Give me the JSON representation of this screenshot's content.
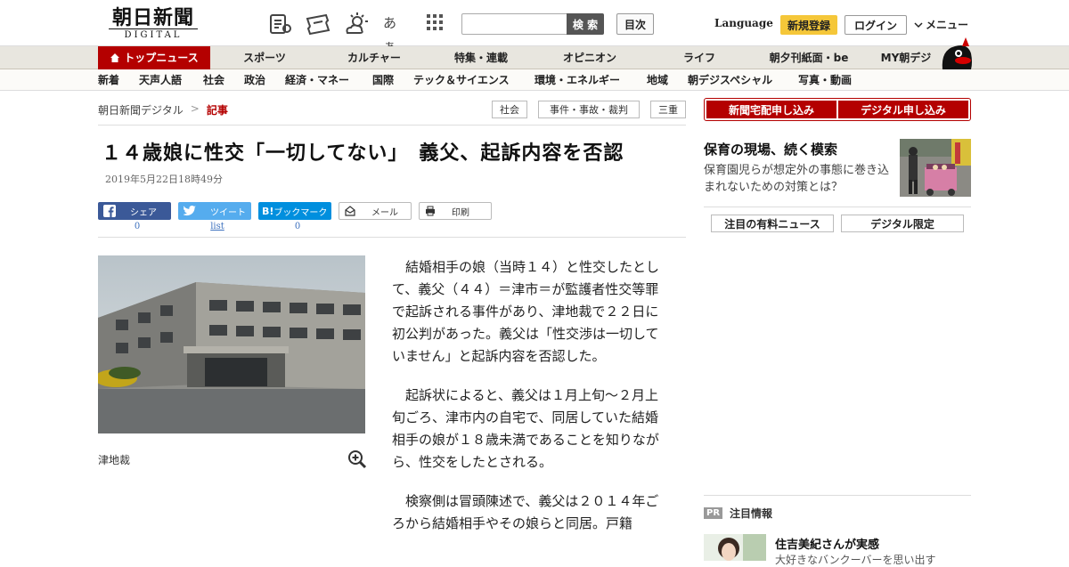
{
  "header": {
    "logo_jp": "朝日新聞",
    "logo_en": "DIGITAL",
    "search_button": "検 索",
    "index_button": "目次",
    "language": "Language",
    "register": "新規登録",
    "login": "ログイン",
    "menu": "メニュー",
    "text_size_icon_label": "あぁ"
  },
  "nav_primary": [
    "トップニュース",
    "スポーツ",
    "カルチャー",
    "特集・連載",
    "オピニオン",
    "ライフ",
    "朝夕刊紙面・be",
    "MY朝デジ"
  ],
  "nav_secondary": [
    "新着",
    "天声人語",
    "社会",
    "政治",
    "経済・マネー",
    "国際",
    "テック＆サイエンス",
    "環境・エネルギー",
    "地域",
    "朝デジスペシャル",
    "写真・動画"
  ],
  "breadcrumb": {
    "home": "朝日新聞デジタル",
    "separator": ">",
    "current": "記事"
  },
  "tags": [
    "社会",
    "事件・事故・裁判",
    "三重"
  ],
  "article": {
    "headline": "１４歳娘に性交「一切してない」　義父、起訴内容を否認",
    "date": "2019年5月22日18時49分",
    "share": {
      "facebook": "シェア",
      "facebook_count": "0",
      "twitter": "ツイート",
      "twitter_count": "list",
      "hatena": "ブックマーク",
      "hatena_badge": "B!",
      "hatena_count": "0",
      "mail": "メール",
      "print": "印刷"
    },
    "photo_caption": "津地裁",
    "paragraphs": [
      "結婚相手の娘（当時１４）と性交したとして、義父（４４）＝津市＝が監護者性交等罪で起訴される事件があり、津地裁で２２日に初公判があった。義父は「性交渉は一切していません」と起訴内容を否認した。",
      "起訴状によると、義父は１月上旬～２月上旬ごろ、津市内の自宅で、同居していた結婚相手の娘が１８歳未満であることを知りながら、性交をしたとされる。",
      "検察側は冒頭陳述で、義父は２０１４年ごろから結婚相手やその娘らと同居。戸籍"
    ]
  },
  "sidebar": {
    "subscribe_paper": "新聞宅配申し込み",
    "subscribe_digital": "デジタル申し込み",
    "feature_title": "保育の現場、続く模索",
    "feature_desc": "保育園児らが想定外の事態に巻き込まれないための対策とは？",
    "btn_paid": "注目の有料ニュース",
    "btn_digital": "デジタル限定",
    "pr_badge": "PR",
    "pr_heading": "注目情報",
    "pr_title": "住吉美紀さんが実感",
    "pr_desc": "大好きなバンクーバーを思い出す"
  },
  "colors": {
    "brand_red": "#b40000",
    "register_yellow": "#f5c739",
    "facebook": "#3b5998",
    "twitter": "#55acee",
    "hatena": "#008fde"
  }
}
